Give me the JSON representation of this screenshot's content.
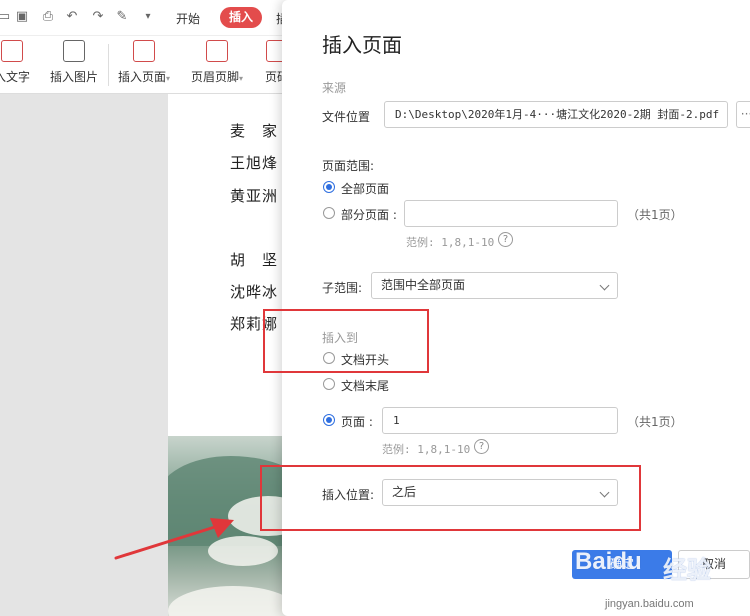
{
  "app": {
    "tabs": {
      "start": "开始",
      "insert": "插入",
      "next": "插"
    },
    "ribbon": [
      {
        "label": "入文字",
        "dropdown": false
      },
      {
        "label": "插入图片",
        "dropdown": false
      },
      {
        "label": "插入页面",
        "dropdown": true
      },
      {
        "label": "页眉页脚",
        "dropdown": true
      },
      {
        "label": "页码",
        "dropdown": false
      }
    ]
  },
  "document": {
    "names": [
      "麦　家",
      "王旭烽",
      "黄亚洲",
      "胡　坚",
      "沈晔冰",
      "郑莉娜"
    ]
  },
  "dialog": {
    "title": "插入页面",
    "source": {
      "group_label": "来源",
      "file_label": "文件位置",
      "file_value": "D:\\Desktop\\2020年1月-4···塘江文化2020-2期 封面-2.pdf",
      "browse_label": "···"
    },
    "page_range": {
      "label": "页面范围:",
      "all_pages": "全部页面",
      "partial_pages": "部分页面 :",
      "partial_value": "",
      "count": "（共1页）",
      "example": "范例: 1,8,1-10",
      "help": "?"
    },
    "sub_range": {
      "label": "子范围:",
      "value": "范围中全部页面"
    },
    "insert_to": {
      "group_label": "插入到",
      "doc_start": "文档开头",
      "doc_end": "文档末尾",
      "page_label": "页面 :",
      "page_value": "1",
      "count": "（共1页）",
      "example": "范例: 1,8,1-10",
      "help": "?"
    },
    "insert_position": {
      "label": "插入位置:",
      "value": "之后"
    },
    "buttons": {
      "ok": "确定",
      "cancel": "取消"
    }
  },
  "watermark": {
    "logo": "Baidu",
    "cn": "经验",
    "url": "jingyan.baidu.com"
  },
  "colors": {
    "accent": "#3b7be8",
    "insert_tab": "#e34c4c",
    "annotation": "#e0373a"
  }
}
